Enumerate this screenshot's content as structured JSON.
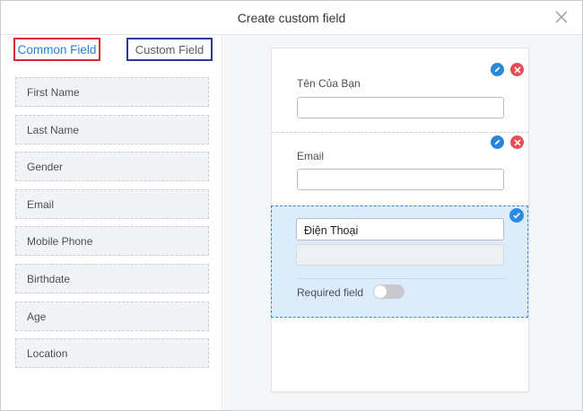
{
  "dialog": {
    "title": "Create custom field"
  },
  "tabs": {
    "common": "Common Field",
    "custom": "Custom Field"
  },
  "common_fields": [
    "First Name",
    "Last Name",
    "Gender",
    "Email",
    "Mobile Phone",
    "Birthdate",
    "Age",
    "Location"
  ],
  "form": {
    "field1": {
      "label": "Tên Của Bạn",
      "value": ""
    },
    "field2": {
      "label": "Email",
      "value": ""
    },
    "field3": {
      "label_input_value": "Điện Thoại",
      "value": "",
      "required_label": "Required field",
      "required_on": false
    }
  },
  "icons": {
    "close": "close-icon",
    "edit": "edit-icon",
    "delete": "delete-icon",
    "check": "check-icon"
  },
  "colors": {
    "accent": "#2a86d8",
    "delete": "#ea4c55",
    "selected_bg": "#dcecfb",
    "common_tab_border": "#e0242c",
    "custom_tab_border": "#2b3a9c"
  }
}
